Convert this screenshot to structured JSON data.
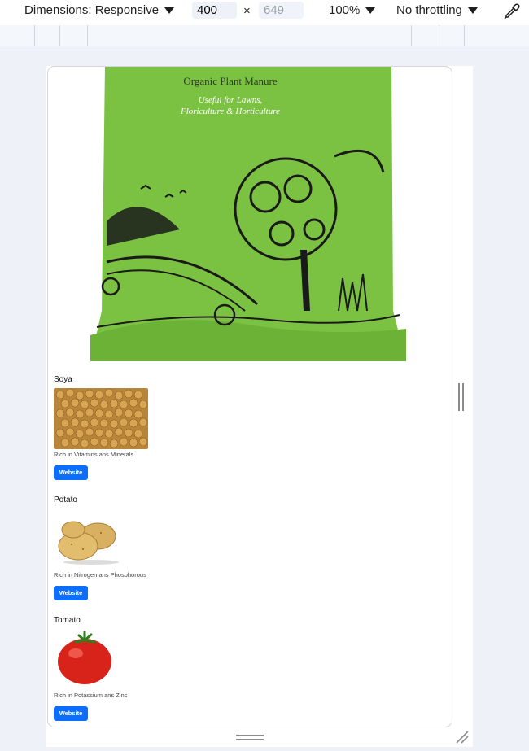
{
  "toolbar": {
    "dimensions_label": "Dimensions: Responsive",
    "width_value": "400",
    "times": "×",
    "height_placeholder": "649",
    "zoom_label": "100%",
    "throttle_label": "No throttling"
  },
  "hero": {
    "subtitle": "Organic Plant Manure",
    "tagline_1": "Useful for Lawns,",
    "tagline_2": "Floriculture & Horticulture"
  },
  "items": [
    {
      "title": "Soya",
      "description": "Rich in Vitamins ans Minerals",
      "button": "Website"
    },
    {
      "title": "Potato",
      "description": "Rich in Nitrogen ans Phosphorous",
      "button": "Website"
    },
    {
      "title": "Tomato",
      "description": "Rich in Potassium ans Zinc",
      "button": "Website"
    }
  ],
  "colors": {
    "button": "#0d6efd",
    "bag_green": "#7cc242"
  }
}
